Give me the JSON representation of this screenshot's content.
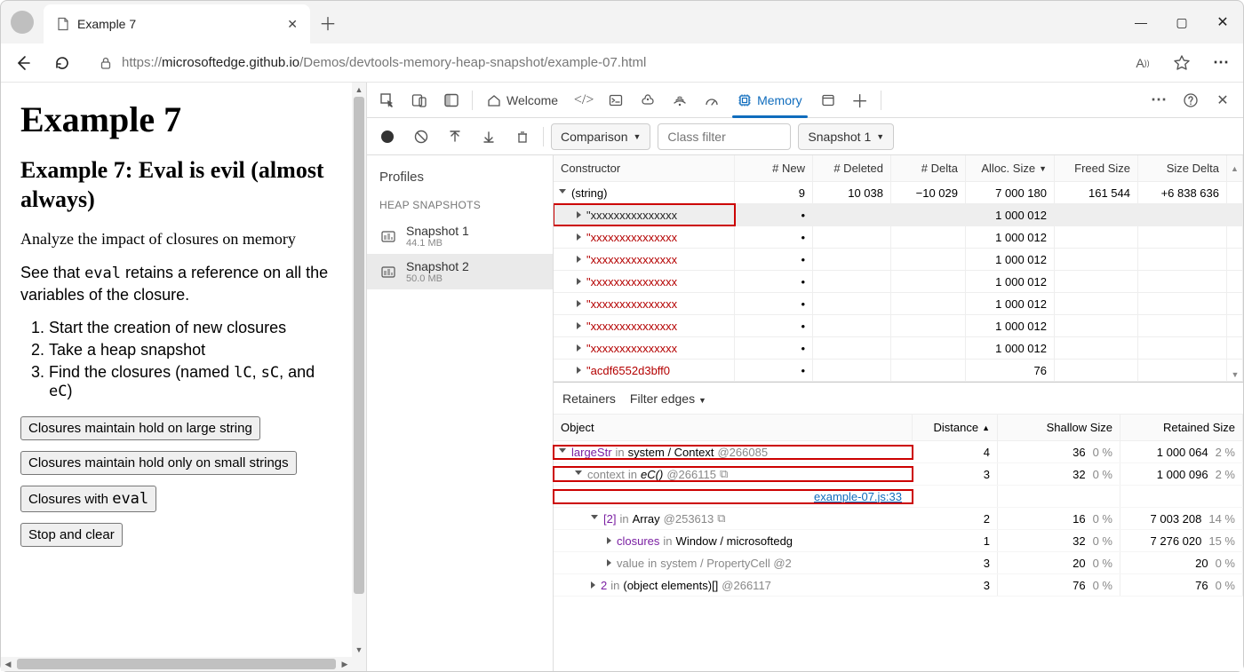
{
  "browser": {
    "tab_title": "Example 7",
    "url_prefix": "https://",
    "url_host": "microsoftedge.github.io",
    "url_path": "/Demos/devtools-memory-heap-snapshot/example-07.html"
  },
  "page": {
    "h1": "Example 7",
    "h2": "Example 7: Eval is evil (almost always)",
    "p1": "Analyze the impact of closures on memory",
    "p2_a": "See that ",
    "p2_code": "eval",
    "p2_b": " retains a reference on all the variables of the closure.",
    "steps": [
      "Start the creation of new closures",
      "Take a heap snapshot",
      "Find the closures (named lC, sC, and eC)"
    ],
    "buttons": [
      "Closures maintain hold on large string",
      "Closures maintain hold only on small strings",
      "Closures with eval",
      "Stop and clear"
    ]
  },
  "devtools": {
    "tabs": {
      "welcome": "Welcome",
      "memory": "Memory"
    },
    "toolbar": {
      "view_select": "Comparison",
      "filter_placeholder": "Class filter",
      "baseline_select": "Snapshot 1"
    },
    "profiles": {
      "header": "Profiles",
      "subheader": "HEAP SNAPSHOTS",
      "items": [
        {
          "name": "Snapshot 1",
          "size": "44.1 MB"
        },
        {
          "name": "Snapshot 2",
          "size": "50.0 MB"
        }
      ]
    },
    "grid": {
      "columns": [
        "Constructor",
        "# New",
        "# Deleted",
        "# Delta",
        "Alloc. Size",
        "Freed Size",
        "Size Delta"
      ],
      "rows": [
        {
          "label": "(string)",
          "indent": 0,
          "open": true,
          "new": "9",
          "del": "10 038",
          "delta": "−10 029",
          "alloc": "7 000 180",
          "freed": "161 544",
          "sdelta": "+6 838 636",
          "color": ""
        },
        {
          "label": "\"xxxxxxxxxxxxxxx",
          "indent": 1,
          "open": false,
          "new": "•",
          "del": "",
          "delta": "",
          "alloc": "1 000 012",
          "freed": "",
          "sdelta": "",
          "color": "#222",
          "selected": true,
          "redbox": true
        },
        {
          "label": "\"xxxxxxxxxxxxxxx",
          "indent": 1,
          "open": false,
          "new": "•",
          "del": "",
          "delta": "",
          "alloc": "1 000 012",
          "freed": "",
          "sdelta": "",
          "color": "str"
        },
        {
          "label": "\"xxxxxxxxxxxxxxx",
          "indent": 1,
          "open": false,
          "new": "•",
          "del": "",
          "delta": "",
          "alloc": "1 000 012",
          "freed": "",
          "sdelta": "",
          "color": "str"
        },
        {
          "label": "\"xxxxxxxxxxxxxxx",
          "indent": 1,
          "open": false,
          "new": "•",
          "del": "",
          "delta": "",
          "alloc": "1 000 012",
          "freed": "",
          "sdelta": "",
          "color": "str"
        },
        {
          "label": "\"xxxxxxxxxxxxxxx",
          "indent": 1,
          "open": false,
          "new": "•",
          "del": "",
          "delta": "",
          "alloc": "1 000 012",
          "freed": "",
          "sdelta": "",
          "color": "str"
        },
        {
          "label": "\"xxxxxxxxxxxxxxx",
          "indent": 1,
          "open": false,
          "new": "•",
          "del": "",
          "delta": "",
          "alloc": "1 000 012",
          "freed": "",
          "sdelta": "",
          "color": "str"
        },
        {
          "label": "\"xxxxxxxxxxxxxxx",
          "indent": 1,
          "open": false,
          "new": "•",
          "del": "",
          "delta": "",
          "alloc": "1 000 012",
          "freed": "",
          "sdelta": "",
          "color": "str"
        },
        {
          "label": "\"acdf6552d3bff0",
          "indent": 1,
          "open": false,
          "new": "•",
          "del": "",
          "delta": "",
          "alloc": "76",
          "freed": "",
          "sdelta": "",
          "color": "str"
        }
      ]
    },
    "retainers": {
      "tab": "Retainers",
      "filter": "Filter edges",
      "columns": [
        "Object",
        "Distance",
        "Shallow Size",
        "Retained Size"
      ],
      "rows": [
        {
          "indent": 0,
          "open": true,
          "parts": [
            {
              "t": "largeStr",
              "c": "purple"
            },
            {
              "t": " in ",
              "c": "gray"
            },
            {
              "t": "system / Context",
              "c": ""
            },
            {
              "t": " @266085",
              "c": "gray"
            }
          ],
          "dist": "4",
          "shal": "36",
          "shal_pct": "0 %",
          "ret": "1 000 064",
          "ret_pct": "2 %",
          "redbox": true
        },
        {
          "indent": 1,
          "open": true,
          "parts": [
            {
              "t": "context",
              "c": "gray"
            },
            {
              "t": " in ",
              "c": "gray"
            },
            {
              "t": "eC()",
              "c": "i"
            },
            {
              "t": " @266115 ",
              "c": "gray"
            },
            {
              "t": "⧉",
              "c": "gray"
            }
          ],
          "dist": "3",
          "shal": "32",
          "shal_pct": "0 %",
          "ret": "1 000 096",
          "ret_pct": "2 %",
          "redbox": true
        },
        {
          "indent": 1,
          "link": "example-07.js:33",
          "redbox": true
        },
        {
          "indent": 2,
          "open": true,
          "parts": [
            {
              "t": "[2]",
              "c": "purple"
            },
            {
              "t": " in ",
              "c": "gray"
            },
            {
              "t": "Array",
              "c": ""
            },
            {
              "t": " @253613 ",
              "c": "gray"
            },
            {
              "t": "⧉",
              "c": "gray"
            }
          ],
          "dist": "2",
          "shal": "16",
          "shal_pct": "0 %",
          "ret": "7 003 208",
          "ret_pct": "14 %"
        },
        {
          "indent": 3,
          "open": false,
          "parts": [
            {
              "t": "closures",
              "c": "purple"
            },
            {
              "t": " in ",
              "c": "gray"
            },
            {
              "t": "Window / microsoftedg",
              "c": ""
            }
          ],
          "dist": "1",
          "shal": "32",
          "shal_pct": "0 %",
          "ret": "7 276 020",
          "ret_pct": "15 %"
        },
        {
          "indent": 3,
          "open": false,
          "parts": [
            {
              "t": "value",
              "c": "gray"
            },
            {
              "t": " in ",
              "c": "gray"
            },
            {
              "t": "system / PropertyCell @2",
              "c": "gray"
            }
          ],
          "dist": "3",
          "shal": "20",
          "shal_pct": "0 %",
          "ret": "20",
          "ret_pct": "0 %"
        },
        {
          "indent": 2,
          "open": false,
          "parts": [
            {
              "t": "2",
              "c": "purple"
            },
            {
              "t": " in ",
              "c": "gray"
            },
            {
              "t": "(object elements)[]",
              "c": ""
            },
            {
              "t": " @266117",
              "c": "gray"
            }
          ],
          "dist": "3",
          "shal": "76",
          "shal_pct": "0 %",
          "ret": "76",
          "ret_pct": "0 %"
        }
      ]
    }
  }
}
